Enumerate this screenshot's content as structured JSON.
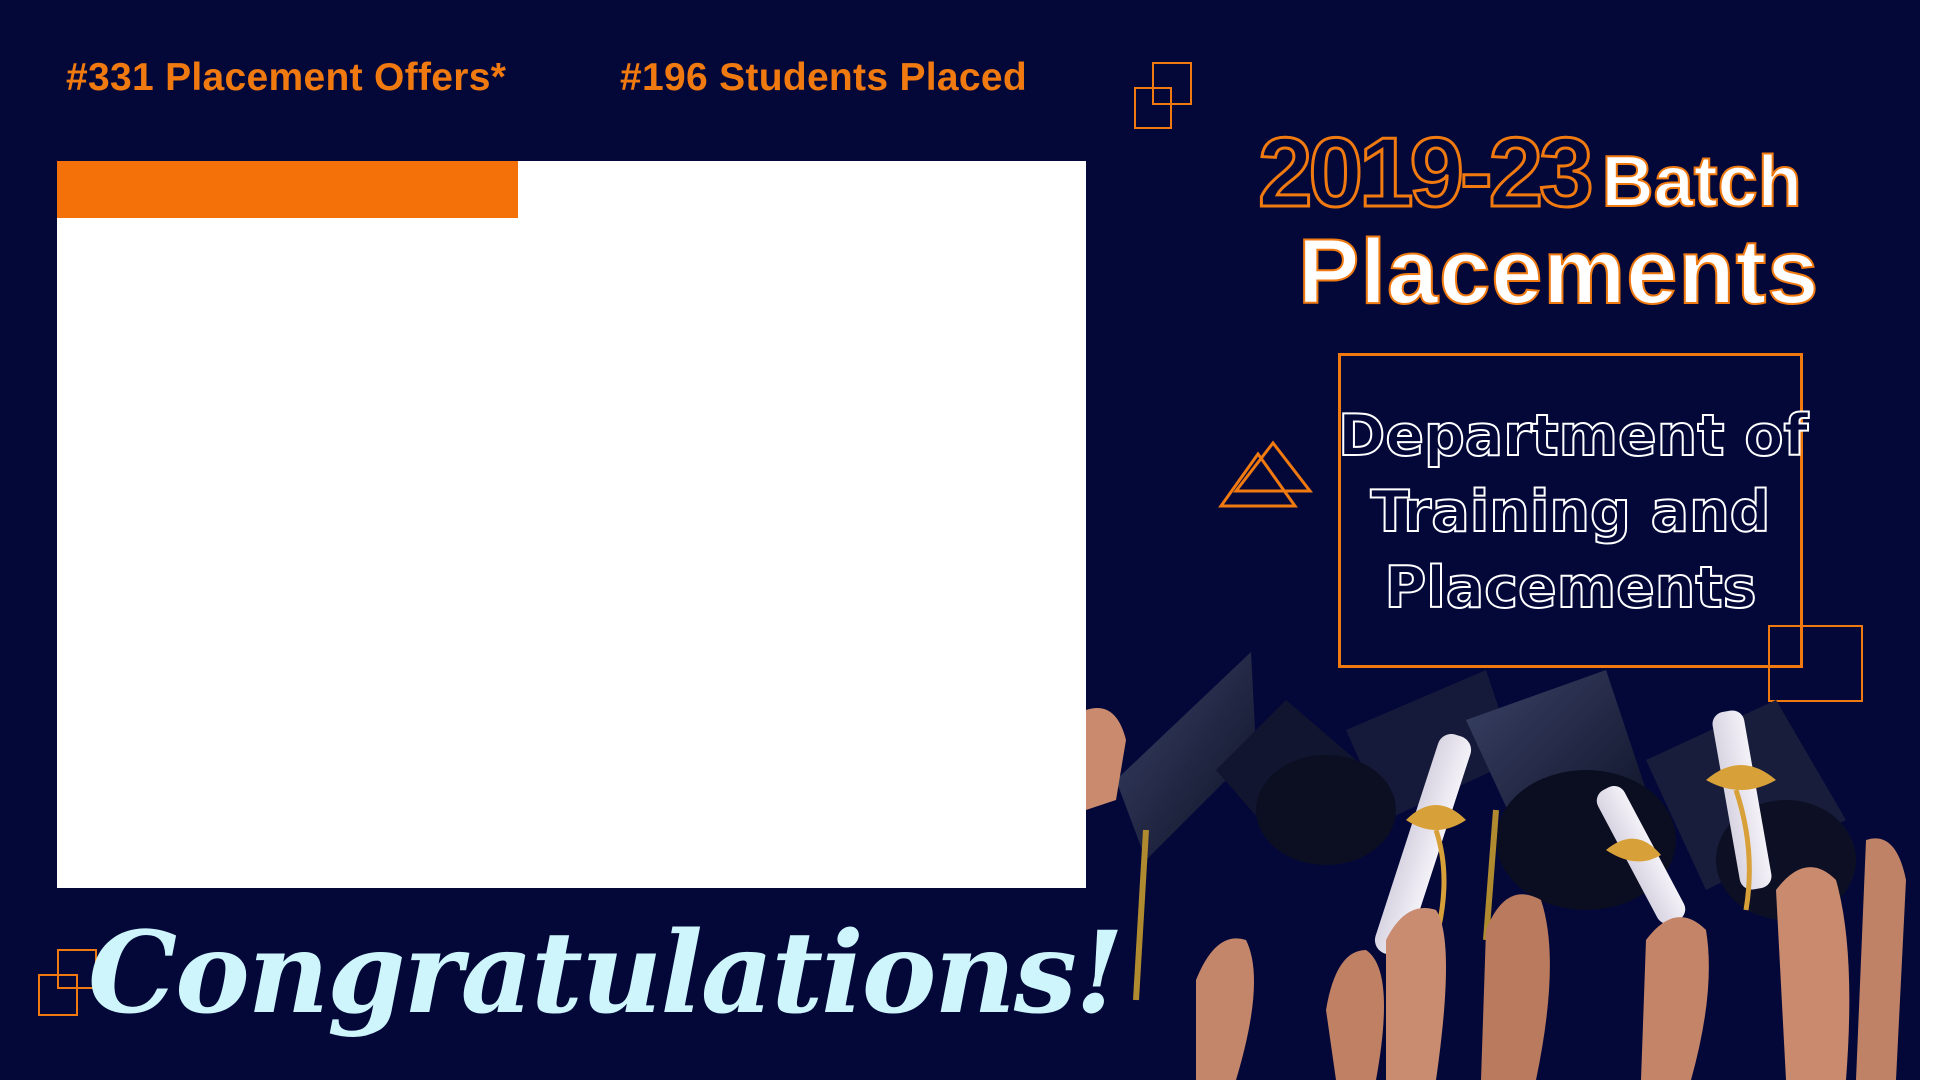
{
  "stats": {
    "offers": "#331 Placement Offers*",
    "students": "#196 Students Placed"
  },
  "heading": {
    "year": "2019-23",
    "batch": "Batch",
    "placements": "Placements"
  },
  "department": {
    "line1": "Department of",
    "line2": "Training and",
    "line3": "Placements"
  },
  "footer": {
    "congrats": "Congratulations!"
  },
  "colors": {
    "background": "#030839",
    "accent_orange": "#f37108",
    "congrats_text": "#cdf5fb"
  },
  "photo": {
    "subject": "graduation caps and diplomas raised by hands"
  }
}
